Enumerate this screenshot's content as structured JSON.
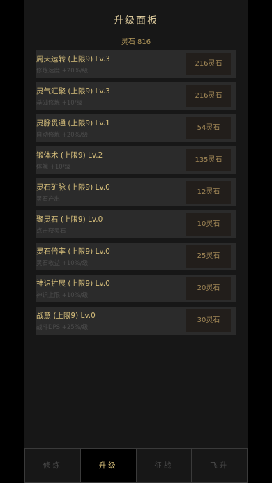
{
  "panel": {
    "title": "升级面板",
    "currency": "灵石 816"
  },
  "upgrades": [
    {
      "name": "周天运转 (上限9) Lv.3",
      "desc": "修炼速度 +20%/级",
      "price": "216灵石"
    },
    {
      "name": "灵气汇聚 (上限9) Lv.3",
      "desc": "基础修炼 +10/级",
      "price": "216灵石"
    },
    {
      "name": "灵脉贯通 (上限9) Lv.1",
      "desc": "自动修炼 +20%/级",
      "price": "54灵石"
    },
    {
      "name": "锻体术 (上限9) Lv.2",
      "desc": "体魄 +10/级",
      "price": "135灵石"
    },
    {
      "name": "灵石矿脉 (上限9) Lv.0",
      "desc": "灵石产出",
      "price": "12灵石"
    },
    {
      "name": "聚灵石 (上限9) Lv.0",
      "desc": "点击获灵石",
      "price": "10灵石"
    },
    {
      "name": "灵石倍率 (上限9) Lv.0",
      "desc": "灵石收益 +10%/级",
      "price": "25灵石"
    },
    {
      "name": "神识扩展 (上限9) Lv.0",
      "desc": "神识上限 +10%/级",
      "price": "20灵石"
    },
    {
      "name": "战意 (上限9) Lv.0",
      "desc": "战斗DPS +25%/级",
      "price": "30灵石"
    }
  ],
  "nav": {
    "tabs": [
      {
        "label": "修炼"
      },
      {
        "label": "升级"
      },
      {
        "label": "征战"
      },
      {
        "label": "飞升"
      }
    ],
    "active": "升级"
  },
  "colors": {
    "page_background": "#000000",
    "panel_background": "#171717",
    "item_background": "#2b2b2b",
    "gold_text": "#d8c07c",
    "button_background": "#221e1b"
  }
}
